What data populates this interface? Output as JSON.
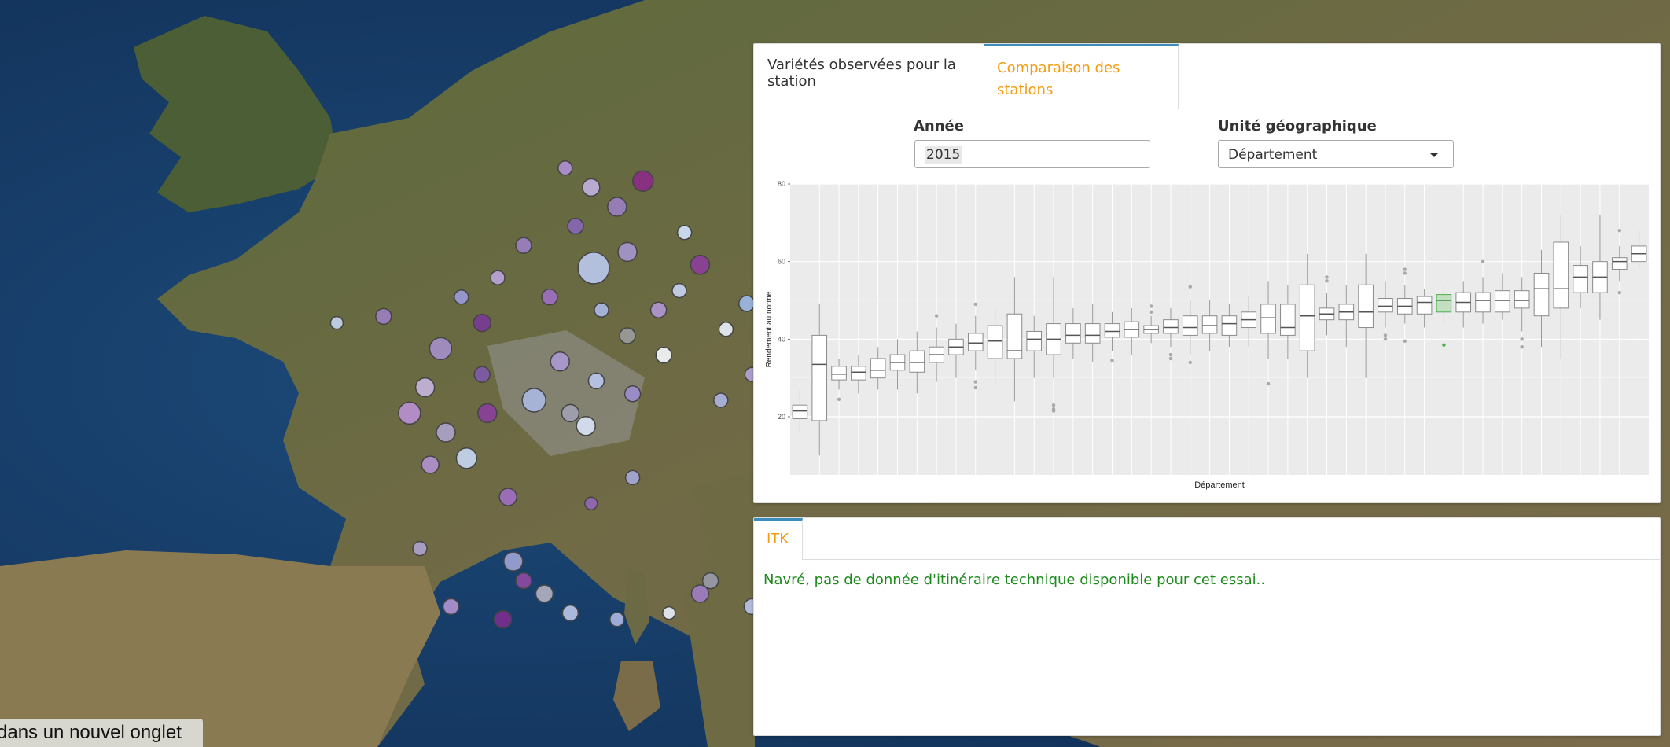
{
  "tabs": [
    {
      "label": "Variétés observées pour la station",
      "active": false
    },
    {
      "label": "Comparaison des stations",
      "active": true
    }
  ],
  "filters": {
    "year_label": "Année",
    "year_value": "2015",
    "geo_label": "Unité géographique",
    "geo_value": "Département"
  },
  "colors": {
    "accent_orange": "#f39c12",
    "tab_border_blue": "#3c8dbc",
    "highlight_green": "#4cae4c",
    "message_green": "#1e8a1e"
  },
  "chart_data": {
    "type": "box",
    "xlabel": "Département",
    "ylabel": "Rendement au norme",
    "ylim": [
      5,
      80
    ],
    "yticks": [
      20,
      40,
      60,
      80
    ],
    "grid": true,
    "highlight_index": 33,
    "boxes": [
      {
        "min": 16,
        "q1": 19.5,
        "median": 21.5,
        "q3": 23,
        "max": 27,
        "outliers": []
      },
      {
        "min": 10,
        "q1": 19,
        "median": 33.5,
        "q3": 41,
        "max": 49,
        "outliers": []
      },
      {
        "min": 27,
        "q1": 29.5,
        "median": 31,
        "q3": 33,
        "max": 35,
        "outliers": [
          24.5
        ]
      },
      {
        "min": 26,
        "q1": 29.5,
        "median": 31.5,
        "q3": 33,
        "max": 36,
        "outliers": []
      },
      {
        "min": 27,
        "q1": 30,
        "median": 32,
        "q3": 35,
        "max": 38,
        "outliers": []
      },
      {
        "min": 27,
        "q1": 32,
        "median": 34,
        "q3": 36,
        "max": 40,
        "outliers": []
      },
      {
        "min": 26,
        "q1": 31.5,
        "median": 34,
        "q3": 37,
        "max": 42,
        "outliers": []
      },
      {
        "min": 29,
        "q1": 34,
        "median": 36,
        "q3": 38,
        "max": 43,
        "outliers": [
          46
        ]
      },
      {
        "min": 30,
        "q1": 36,
        "median": 38,
        "q3": 40,
        "max": 44,
        "outliers": []
      },
      {
        "min": 32,
        "q1": 37,
        "median": 39,
        "q3": 41.5,
        "max": 46,
        "outliers": [
          49,
          29,
          27.5
        ]
      },
      {
        "min": 28,
        "q1": 35,
        "median": 39.5,
        "q3": 43.5,
        "max": 48,
        "outliers": []
      },
      {
        "min": 24,
        "q1": 35,
        "median": 37,
        "q3": 46.5,
        "max": 56,
        "outliers": []
      },
      {
        "min": 30,
        "q1": 37,
        "median": 40,
        "q3": 42,
        "max": 46,
        "outliers": []
      },
      {
        "min": 30,
        "q1": 36,
        "median": 40,
        "q3": 44,
        "max": 56,
        "outliers": [
          23,
          22,
          21.5
        ]
      },
      {
        "min": 35,
        "q1": 39,
        "median": 41,
        "q3": 44,
        "max": 48,
        "outliers": []
      },
      {
        "min": 34,
        "q1": 39,
        "median": 41,
        "q3": 44,
        "max": 49,
        "outliers": []
      },
      {
        "min": 37,
        "q1": 40.5,
        "median": 42,
        "q3": 44,
        "max": 47,
        "outliers": [
          34.5
        ]
      },
      {
        "min": 36,
        "q1": 40.5,
        "median": 42.5,
        "q3": 44.5,
        "max": 48,
        "outliers": []
      },
      {
        "min": 39,
        "q1": 41.5,
        "median": 42.5,
        "q3": 43.5,
        "max": 46,
        "outliers": [
          48.5,
          47
        ]
      },
      {
        "min": 38,
        "q1": 41.5,
        "median": 43,
        "q3": 45,
        "max": 48,
        "outliers": [
          35,
          36
        ]
      },
      {
        "min": 36,
        "q1": 41,
        "median": 43,
        "q3": 46,
        "max": 50,
        "outliers": [
          53.5,
          34
        ]
      },
      {
        "min": 37,
        "q1": 41.5,
        "median": 43.5,
        "q3": 46,
        "max": 50,
        "outliers": []
      },
      {
        "min": 38,
        "q1": 41,
        "median": 44,
        "q3": 46,
        "max": 49,
        "outliers": []
      },
      {
        "min": 38,
        "q1": 43,
        "median": 45,
        "q3": 47,
        "max": 51,
        "outliers": []
      },
      {
        "min": 35,
        "q1": 41.5,
        "median": 45.5,
        "q3": 49,
        "max": 55,
        "outliers": [
          28.5
        ]
      },
      {
        "min": 35,
        "q1": 41,
        "median": 43,
        "q3": 49,
        "max": 54,
        "outliers": []
      },
      {
        "min": 30,
        "q1": 37,
        "median": 46,
        "q3": 54,
        "max": 62,
        "outliers": []
      },
      {
        "min": 41,
        "q1": 45,
        "median": 46.5,
        "q3": 48,
        "max": 52,
        "outliers": [
          56,
          55
        ]
      },
      {
        "min": 38,
        "q1": 45,
        "median": 47,
        "q3": 49,
        "max": 54,
        "outliers": []
      },
      {
        "min": 30,
        "q1": 43,
        "median": 47,
        "q3": 54,
        "max": 62,
        "outliers": []
      },
      {
        "min": 43,
        "q1": 47,
        "median": 48.5,
        "q3": 50.5,
        "max": 55,
        "outliers": [
          41,
          40
        ]
      },
      {
        "min": 44,
        "q1": 46.5,
        "median": 48.5,
        "q3": 50.5,
        "max": 54,
        "outliers": [
          58,
          57,
          39.5
        ]
      },
      {
        "min": 43,
        "q1": 46.5,
        "median": 49.5,
        "q3": 51,
        "max": 53,
        "outliers": []
      },
      {
        "min": 44,
        "q1": 47,
        "median": 50,
        "q3": 51.5,
        "max": 54,
        "outliers": [
          38.5
        ]
      },
      {
        "min": 43,
        "q1": 47,
        "median": 49.5,
        "q3": 52,
        "max": 55,
        "outliers": []
      },
      {
        "min": 44,
        "q1": 47,
        "median": 50,
        "q3": 52,
        "max": 56,
        "outliers": [
          60
        ]
      },
      {
        "min": 45,
        "q1": 47,
        "median": 50,
        "q3": 52.5,
        "max": 57,
        "outliers": []
      },
      {
        "min": 42,
        "q1": 48,
        "median": 50,
        "q3": 52.5,
        "max": 56,
        "outliers": [
          40,
          38
        ]
      },
      {
        "min": 38,
        "q1": 46,
        "median": 53,
        "q3": 57,
        "max": 63,
        "outliers": []
      },
      {
        "min": 35,
        "q1": 48,
        "median": 53,
        "q3": 65,
        "max": 72,
        "outliers": []
      },
      {
        "min": 48,
        "q1": 52,
        "median": 56,
        "q3": 59,
        "max": 64,
        "outliers": []
      },
      {
        "min": 45,
        "q1": 52,
        "median": 56,
        "q3": 60,
        "max": 72,
        "outliers": []
      },
      {
        "min": 55,
        "q1": 58,
        "median": 60,
        "q3": 61,
        "max": 64,
        "outliers": [
          68,
          52
        ]
      },
      {
        "min": 58,
        "q1": 60,
        "median": 62,
        "q3": 64,
        "max": 68,
        "outliers": []
      }
    ]
  },
  "bottom_tab": {
    "label": "ITK"
  },
  "bottom_message": "Navré, pas de donnée d'itinéraire technique disponible pour cet essai..",
  "tooltip_text": "dans un nouvel onglet",
  "map_points": [
    {
      "lon": -1.7,
      "lat": 48.1,
      "c": "#9a7fc0",
      "r": 10
    },
    {
      "lon": -2.6,
      "lat": 48.0,
      "c": "#c3d2ec",
      "r": 8
    },
    {
      "lon": -0.6,
      "lat": 47.6,
      "c": "#a48fc7",
      "r": 14
    },
    {
      "lon": 0.2,
      "lat": 48.0,
      "c": "#7a3a93",
      "r": 11
    },
    {
      "lon": 0.5,
      "lat": 48.7,
      "c": "#b9a4d8",
      "r": 9
    },
    {
      "lon": 1.5,
      "lat": 48.4,
      "c": "#9d6fc1",
      "r": 10
    },
    {
      "lon": 2.35,
      "lat": 48.85,
      "c": "#b9c8ea",
      "r": 20
    },
    {
      "lon": 3.0,
      "lat": 49.1,
      "c": "#a496cc",
      "r": 12
    },
    {
      "lon": 2.0,
      "lat": 49.5,
      "c": "#8767b3",
      "r": 10
    },
    {
      "lon": 2.8,
      "lat": 49.8,
      "c": "#9a7fc0",
      "r": 12
    },
    {
      "lon": 3.3,
      "lat": 50.2,
      "c": "#8a2d86",
      "r": 13
    },
    {
      "lon": 1.8,
      "lat": 50.4,
      "c": "#ad8fd0",
      "r": 9
    },
    {
      "lon": 2.3,
      "lat": 50.1,
      "c": "#c0b0dd",
      "r": 11
    },
    {
      "lon": 4.1,
      "lat": 49.4,
      "c": "#cfe0f7",
      "r": 9
    },
    {
      "lon": 4.4,
      "lat": 48.9,
      "c": "#8c3f99",
      "r": 12
    },
    {
      "lon": 5.8,
      "lat": 48.9,
      "c": "#9e82c8",
      "r": 15
    },
    {
      "lon": 6.1,
      "lat": 48.7,
      "c": "#c9d6f0",
      "r": 16
    },
    {
      "lon": 5.3,
      "lat": 48.3,
      "c": "#9bb7e4",
      "r": 10
    },
    {
      "lon": 4.9,
      "lat": 47.9,
      "c": "#e8eef8",
      "r": 9
    },
    {
      "lon": 3.7,
      "lat": 47.5,
      "c": "#f4f6fa",
      "r": 10
    },
    {
      "lon": 3.0,
      "lat": 47.8,
      "c": "#9a9a9a",
      "r": 10
    },
    {
      "lon": 2.4,
      "lat": 47.1,
      "c": "#b8c6e8",
      "r": 10
    },
    {
      "lon": 1.7,
      "lat": 47.4,
      "c": "#aa99d0",
      "r": 12
    },
    {
      "lon": 1.2,
      "lat": 46.8,
      "c": "#aab6e0",
      "r": 15
    },
    {
      "lon": 0.3,
      "lat": 46.6,
      "c": "#8a3f9a",
      "r": 12
    },
    {
      "lon": -0.5,
      "lat": 46.3,
      "c": "#aaa3c8",
      "r": 12
    },
    {
      "lon": -0.1,
      "lat": 45.9,
      "c": "#c7d6f0",
      "r": 13
    },
    {
      "lon": -0.8,
      "lat": 45.8,
      "c": "#b090cc",
      "r": 11
    },
    {
      "lon": 0.7,
      "lat": 45.3,
      "c": "#9d6fc1",
      "r": 11
    },
    {
      "lon": 1.9,
      "lat": 46.6,
      "c": "#a0a0b0",
      "r": 11
    },
    {
      "lon": 2.2,
      "lat": 46.4,
      "c": "#d8e2f4",
      "r": 12
    },
    {
      "lon": 3.1,
      "lat": 46.9,
      "c": "#9c8ccc",
      "r": 10
    },
    {
      "lon": 4.8,
      "lat": 46.8,
      "c": "#aab3de",
      "r": 9
    },
    {
      "lon": 5.4,
      "lat": 47.2,
      "c": "#b2a2d6",
      "r": 9
    },
    {
      "lon": 5.6,
      "lat": 46.0,
      "c": "#a37bc6",
      "r": 11
    },
    {
      "lon": 5.9,
      "lat": 45.7,
      "c": "#c8d4ee",
      "r": 10
    },
    {
      "lon": 3.1,
      "lat": 45.6,
      "c": "#a6a8d8",
      "r": 9
    },
    {
      "lon": 2.3,
      "lat": 45.2,
      "c": "#9165b4",
      "r": 8
    },
    {
      "lon": 0.8,
      "lat": 44.3,
      "c": "#9aa3d4",
      "r": 12
    },
    {
      "lon": 1.4,
      "lat": 43.8,
      "c": "#b0b0c0",
      "r": 11
    },
    {
      "lon": 1.9,
      "lat": 43.5,
      "c": "#b8c4e6",
      "r": 10
    },
    {
      "lon": 0.6,
      "lat": 43.4,
      "c": "#7a2e8e",
      "r": 11
    },
    {
      "lon": -0.4,
      "lat": 43.6,
      "c": "#b091d0",
      "r": 10
    },
    {
      "lon": 2.8,
      "lat": 43.4,
      "c": "#a9b6e2",
      "r": 9
    },
    {
      "lon": 4.6,
      "lat": 44.0,
      "c": "#9a9aa8",
      "r": 10
    },
    {
      "lon": 5.4,
      "lat": 43.6,
      "c": "#b6c3e6",
      "r": 10
    },
    {
      "lon": 4.4,
      "lat": 43.8,
      "c": "#9f7cc4",
      "r": 11
    },
    {
      "lon": 3.8,
      "lat": 43.5,
      "c": "#e6ecf6",
      "r": 8
    },
    {
      "lon": 1.0,
      "lat": 44.0,
      "c": "#8c4aa4",
      "r": 10
    },
    {
      "lon": -1.0,
      "lat": 44.5,
      "c": "#aaa2cc",
      "r": 9
    },
    {
      "lon": 0.2,
      "lat": 47.2,
      "c": "#7e5aa8",
      "r": 10
    },
    {
      "lon": -0.9,
      "lat": 47.0,
      "c": "#c4b4dc",
      "r": 12
    },
    {
      "lon": -1.2,
      "lat": 46.6,
      "c": "#b98fd0",
      "r": 14
    },
    {
      "lon": -0.2,
      "lat": 48.4,
      "c": "#9a9ad8",
      "r": 9
    },
    {
      "lon": 3.6,
      "lat": 48.2,
      "c": "#b096d0",
      "r": 10
    },
    {
      "lon": 4.0,
      "lat": 48.5,
      "c": "#c6d2ef",
      "r": 9
    },
    {
      "lon": 1.0,
      "lat": 49.2,
      "c": "#9a7fc0",
      "r": 10
    },
    {
      "lon": 2.5,
      "lat": 48.2,
      "c": "#a9b7e3",
      "r": 9
    }
  ]
}
